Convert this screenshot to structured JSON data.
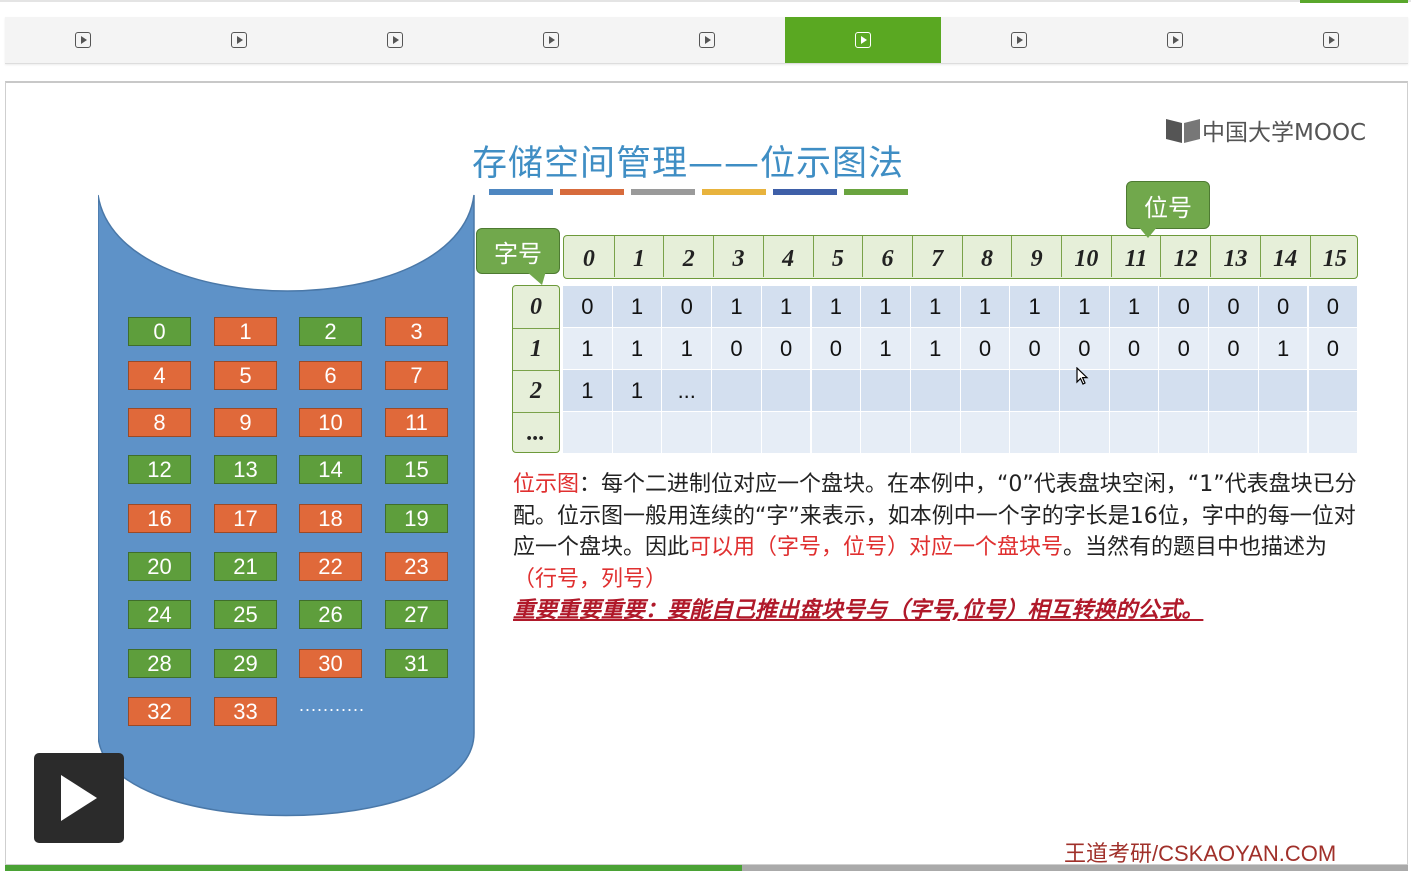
{
  "nav": {
    "segments": 9,
    "active_index": 5
  },
  "slide": {
    "title": "存储空间管理——位示图法",
    "title_bar_colors": [
      "#4e87c1",
      "#d76b3c",
      "#9a9a9a",
      "#e8b33d",
      "#3e5fa8",
      "#6aa43f"
    ],
    "logo_text": "中国大学MOOC",
    "footer": "王道考研/CSKAOYAN.COM"
  },
  "blocks": [
    {
      "n": "0",
      "c": "g"
    },
    {
      "n": "1",
      "c": "o"
    },
    {
      "n": "2",
      "c": "g"
    },
    {
      "n": "3",
      "c": "o"
    },
    {
      "n": "4",
      "c": "o"
    },
    {
      "n": "5",
      "c": "o"
    },
    {
      "n": "6",
      "c": "o"
    },
    {
      "n": "7",
      "c": "o"
    },
    {
      "n": "8",
      "c": "o"
    },
    {
      "n": "9",
      "c": "o"
    },
    {
      "n": "10",
      "c": "o"
    },
    {
      "n": "11",
      "c": "o"
    },
    {
      "n": "12",
      "c": "g"
    },
    {
      "n": "13",
      "c": "g"
    },
    {
      "n": "14",
      "c": "g"
    },
    {
      "n": "15",
      "c": "g"
    },
    {
      "n": "16",
      "c": "o"
    },
    {
      "n": "17",
      "c": "o"
    },
    {
      "n": "18",
      "c": "o"
    },
    {
      "n": "19",
      "c": "g"
    },
    {
      "n": "20",
      "c": "g"
    },
    {
      "n": "21",
      "c": "g"
    },
    {
      "n": "22",
      "c": "o"
    },
    {
      "n": "23",
      "c": "o"
    },
    {
      "n": "24",
      "c": "g"
    },
    {
      "n": "25",
      "c": "g"
    },
    {
      "n": "26",
      "c": "g"
    },
    {
      "n": "27",
      "c": "g"
    },
    {
      "n": "28",
      "c": "g"
    },
    {
      "n": "29",
      "c": "g"
    },
    {
      "n": "30",
      "c": "o"
    },
    {
      "n": "31",
      "c": "g"
    },
    {
      "n": "32",
      "c": "o"
    },
    {
      "n": "33",
      "c": "o"
    }
  ],
  "blocks_more": "...........",
  "bitmap": {
    "col_headers": [
      "0",
      "1",
      "2",
      "3",
      "4",
      "5",
      "6",
      "7",
      "8",
      "9",
      "10",
      "11",
      "12",
      "13",
      "14",
      "15"
    ],
    "row_headers": [
      "0",
      "1",
      "2",
      "..."
    ],
    "rows": [
      [
        "0",
        "1",
        "0",
        "1",
        "1",
        "1",
        "1",
        "1",
        "1",
        "1",
        "1",
        "1",
        "0",
        "0",
        "0",
        "0"
      ],
      [
        "1",
        "1",
        "1",
        "0",
        "0",
        "0",
        "1",
        "1",
        "0",
        "0",
        "0",
        "0",
        "0",
        "0",
        "1",
        "0"
      ],
      [
        "1",
        "1",
        "...",
        "",
        "",
        "",
        "",
        "",
        "",
        "",
        "",
        "",
        "",
        "",
        "",
        ""
      ],
      [
        "",
        "",
        "",
        "",
        "",
        "",
        "",
        "",
        "",
        "",
        "",
        "",
        "",
        "",
        "",
        ""
      ]
    ],
    "callout_row": "字号",
    "callout_col": "位号"
  },
  "text": {
    "p1_label": "位示图",
    "p1_rest": "：每个二进制位对应一个盘块。在本例中，“0”代表盘块空闲，“1”代表盘块已分配。位示图一般用连续的“字”来表示，如本例中一个字的字长是16位，字中的每一位对应一个盘块。因此",
    "p1_red": "可以用（字号，位号）对应一个盘块号",
    "p1_mid": "。当然有的题目中也描述为",
    "p1_red2": "（行号，列号）",
    "p2": "重要重要重要：要能自己推出盘块号与（字号,位号）相互转换的公式。"
  },
  "video": {
    "progress": 0.525
  }
}
